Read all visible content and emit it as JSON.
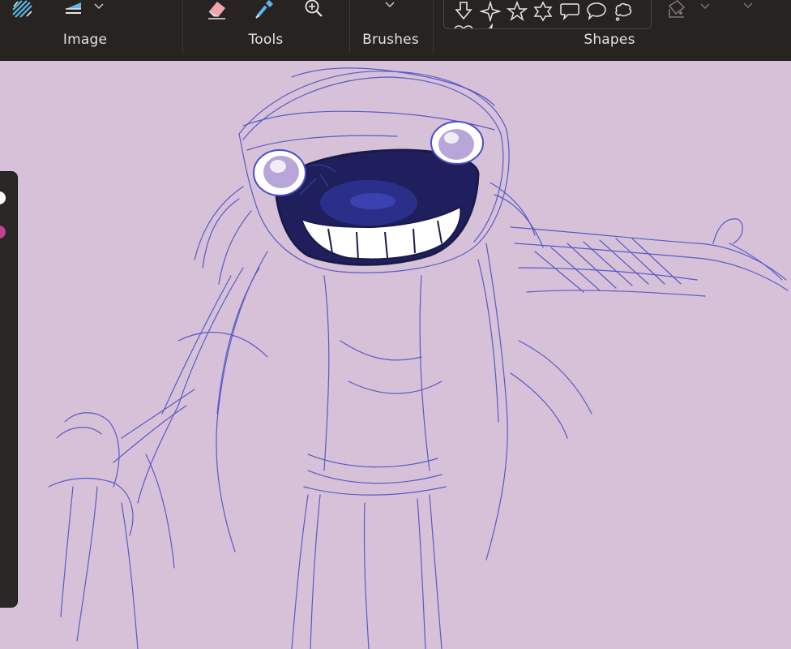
{
  "toolbar": {
    "groups": {
      "image": "Image",
      "tools": "Tools",
      "brushes": "Brushes",
      "shapes": "Shapes"
    },
    "icons": {
      "selection": "selection-tool-icon",
      "layers": "layers-icon",
      "eraser": "eraser-icon",
      "color_picker": "color-picker-icon",
      "zoom": "zoom-icon",
      "fill": "fill-icon"
    }
  },
  "shapes": [
    "arrow-down-icon",
    "four-point-star-icon",
    "five-point-star-icon",
    "six-point-star-icon",
    "rect-callout-icon",
    "oval-callout-icon",
    "cloud-callout-icon",
    "heart-icon",
    "lightning-icon"
  ],
  "side_panel": {
    "swatches": [
      {
        "name": "primary-color-swatch",
        "color": "#ffffff"
      },
      {
        "name": "secondary-color-swatch",
        "color": "#c0428f"
      }
    ]
  },
  "canvas": {
    "background": "#d7c1d8",
    "stroke_color": "#4b4fc4",
    "mouth_color": "#1e1f5c",
    "eye_color": "#b8a6d8"
  }
}
